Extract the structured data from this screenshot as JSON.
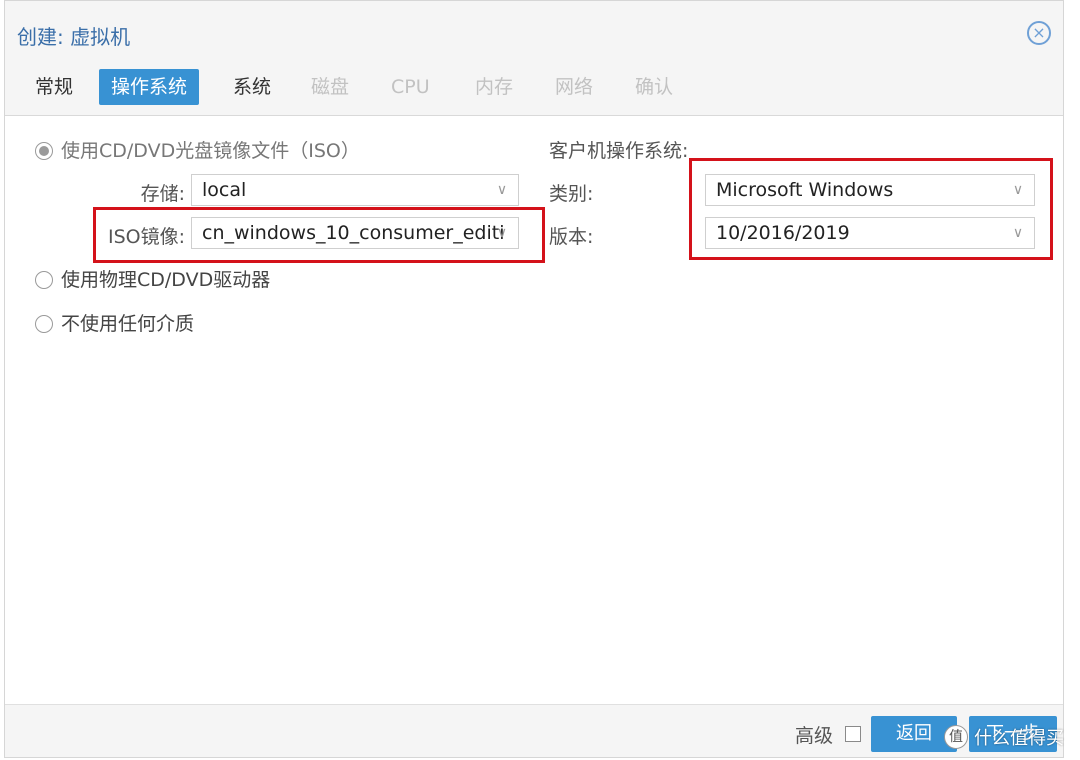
{
  "window": {
    "title": "创建: 虚拟机"
  },
  "tabs": [
    {
      "label": "常规",
      "state": "normal"
    },
    {
      "label": "操作系统",
      "state": "active"
    },
    {
      "label": "系统",
      "state": "normal"
    },
    {
      "label": "磁盘",
      "state": "disabled"
    },
    {
      "label": "CPU",
      "state": "disabled"
    },
    {
      "label": "内存",
      "state": "disabled"
    },
    {
      "label": "网络",
      "state": "disabled"
    },
    {
      "label": "确认",
      "state": "disabled"
    }
  ],
  "media": {
    "iso_option": "使用CD/DVD光盘镜像文件（ISO）",
    "storage_label": "存储:",
    "storage_value": "local",
    "iso_label": "ISO镜像:",
    "iso_value": "cn_windows_10_consumer_editi",
    "physical_option": "使用物理CD/DVD驱动器",
    "none_option": "不使用任何介质"
  },
  "guest_os": {
    "heading": "客户机操作系统:",
    "type_label": "类别:",
    "type_value": "Microsoft Windows",
    "version_label": "版本:",
    "version_value": "10/2016/2019"
  },
  "footer": {
    "advanced_label": "高级",
    "back_button": "返回",
    "next_button": "下一步"
  },
  "watermark": {
    "logo": "值",
    "text": "什么值得买"
  },
  "colors": {
    "accent": "#3892d3",
    "highlight_box": "#d4121a",
    "title_text": "#3b6fa9"
  },
  "icons": {
    "close": "close-circle-icon",
    "dropdown": "chevron-down-icon"
  }
}
